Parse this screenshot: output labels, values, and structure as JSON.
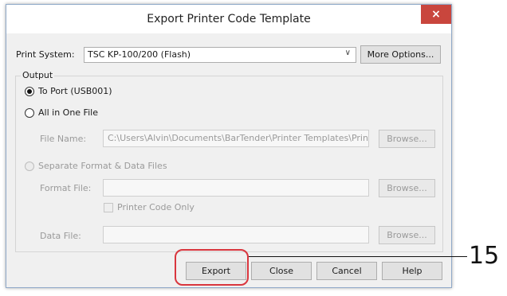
{
  "window": {
    "title": "Export Printer Code Template",
    "close_glyph": "×"
  },
  "print_system": {
    "label": "Print System:",
    "value": "TSC KP-100/200 (Flash)",
    "more_options_label": "More Options..."
  },
  "output": {
    "group_label": "Output",
    "to_port_label": "To Port (USB001)",
    "all_in_one_label": "All in One File",
    "file_name_label": "File Name:",
    "file_name_value": "C:\\Users\\Alvin\\Documents\\BarTender\\Printer Templates\\PrinterTempl",
    "separate_label": "Separate Format & Data Files",
    "format_file_label": "Format File:",
    "format_file_value": "",
    "printer_code_only_label": "Printer Code Only",
    "data_file_label": "Data File:",
    "data_file_value": "",
    "browse_label": "Browse..."
  },
  "footer": {
    "export_label": "Export",
    "close_label": "Close",
    "cancel_label": "Cancel",
    "help_label": "Help"
  },
  "annotation": {
    "callout_number": "15",
    "highlight_color": "#d9363e"
  },
  "colors": {
    "close_button": "#c9463d",
    "dialog_bg": "#f0f0f0",
    "disabled_text": "#9a9a9a"
  }
}
